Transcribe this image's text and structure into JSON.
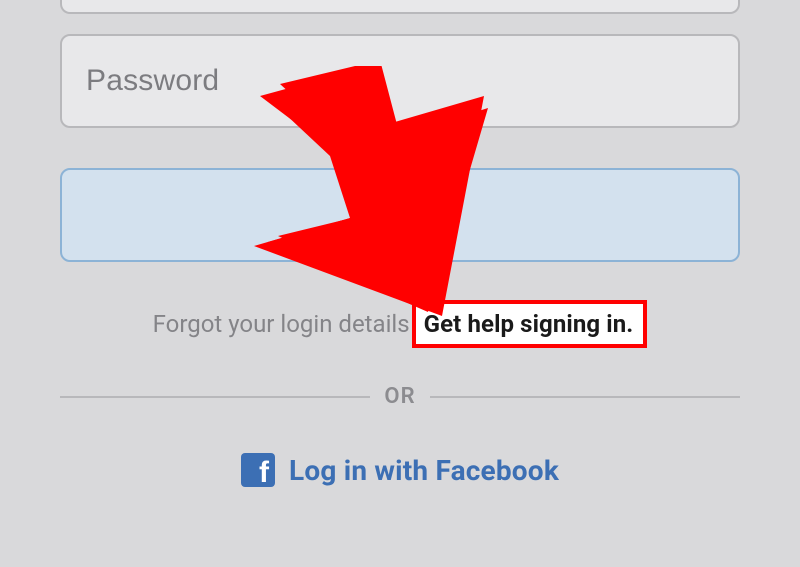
{
  "inputs": {
    "password_placeholder": "Password",
    "password_value": "",
    "login_button_label": ""
  },
  "forgot": {
    "prompt": "Forgot your login details",
    "help_link": "Get help signing in."
  },
  "divider": {
    "or_label": "OR"
  },
  "facebook": {
    "button_label": "Log in with Facebook"
  }
}
